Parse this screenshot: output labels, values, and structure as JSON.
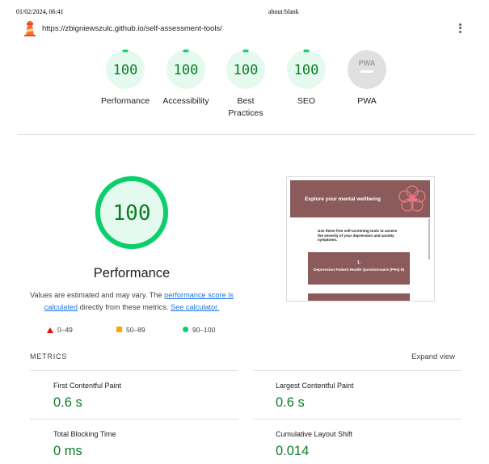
{
  "print_header": {
    "date": "01/02/2024, 06:41",
    "title": "about:blank"
  },
  "urlbar": {
    "url": "https://zbigniewszulc.github.io/self-assessment-tools/"
  },
  "icons": {
    "logo": "lighthouse-logo-icon",
    "menu": "kebab-menu-icon"
  },
  "colors": {
    "pass": "#0cce6b",
    "pass_text": "#0c7c26",
    "pass_fill": "#e5faef",
    "na": "#e0e0e0",
    "fail": "#eb0f00",
    "average": "#ffa400",
    "link": "#1a73e8",
    "screenshot_brand": "#8b5a5a"
  },
  "gauges": [
    {
      "id": "performance",
      "label": "Performance",
      "score": 100
    },
    {
      "id": "accessibility",
      "label": "Accessibility",
      "score": 100
    },
    {
      "id": "best-practices",
      "label_line1": "Best",
      "label_line2": "Practices",
      "score": 100
    },
    {
      "id": "seo",
      "label": "SEO",
      "score": 100
    },
    {
      "id": "pwa",
      "label": "PWA",
      "badge_text": "PWA"
    }
  ],
  "performance": {
    "score": "100",
    "title": "Performance",
    "desc_part1": "Values are estimated and may vary. The ",
    "link_score": "performance score is calculated",
    "desc_part2": " directly from these metrics. ",
    "link_calc": "See calculator."
  },
  "legend": {
    "fail": "0–49",
    "average": "50–89",
    "pass": "90–100"
  },
  "screenshot": {
    "hero": "Explore your mental wellbeing",
    "body": "Use these free self-screening tools to assess the severity of your depression and anxiety symptoms.",
    "card_num": "1.",
    "card_text": "Depression Patient Health Questionnaire (PHQ-9)"
  },
  "metrics": {
    "title": "METRICS",
    "expand": "Expand view",
    "items": [
      {
        "label": "First Contentful Paint",
        "value": "0.6 s"
      },
      {
        "label": "Largest Contentful Paint",
        "value": "0.6 s"
      },
      {
        "label": "Total Blocking Time",
        "value": "0 ms"
      },
      {
        "label": "Cumulative Layout Shift",
        "value": "0.014"
      }
    ]
  }
}
